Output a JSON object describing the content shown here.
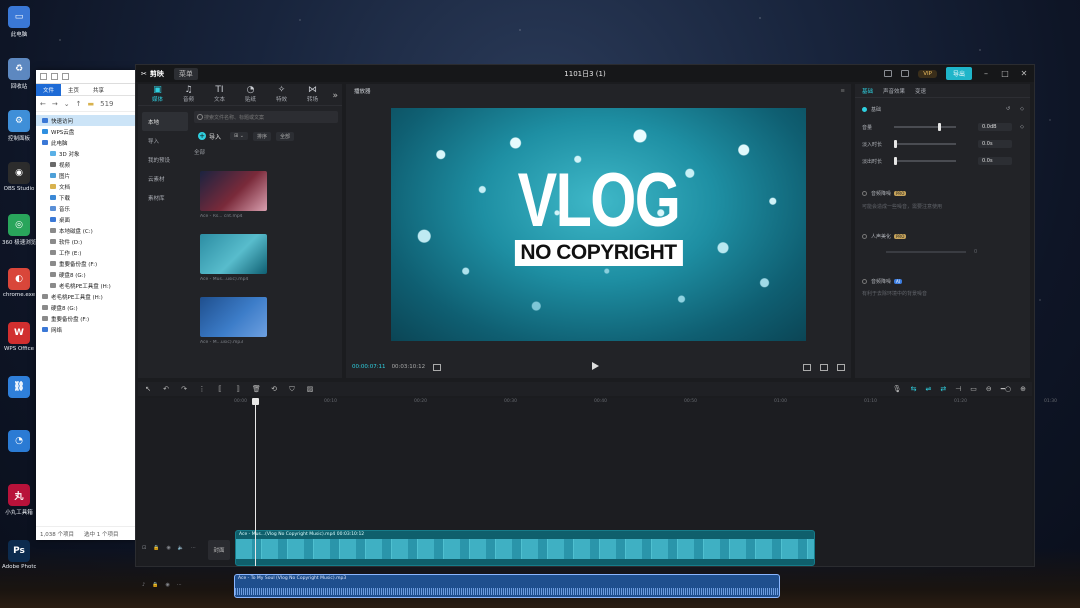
{
  "desktop": {
    "icons": [
      {
        "label": "此电脑",
        "color": "#3a78d6",
        "glyph": "▭"
      },
      {
        "label": "回收站",
        "color": "#5d88c0",
        "glyph": "♻"
      },
      {
        "label": "控制面板",
        "color": "#3f8fd8",
        "glyph": "⚙"
      },
      {
        "label": "OBS Studio",
        "color": "#2c2c2c",
        "glyph": "◉"
      },
      {
        "label": "360 极速浏览器",
        "color": "#29a55b",
        "glyph": "◎"
      },
      {
        "label": "chrome.exe",
        "color": "#d9463a",
        "glyph": "◐"
      },
      {
        "label": "WPS Office",
        "color": "#d12f2f",
        "glyph": "W"
      },
      {
        "label": "",
        "color": "#2f7fd9",
        "glyph": "⛓"
      },
      {
        "label": "",
        "color": "#2b7bd4",
        "glyph": "◔"
      },
      {
        "label": "小丸工具箱",
        "color": "#b8123a",
        "glyph": "丸"
      },
      {
        "label": "Adobe Photosh...",
        "color": "#0c2b4e",
        "glyph": "Ps"
      }
    ]
  },
  "explorer": {
    "ribbon_tabs": [
      "文件",
      "主页",
      "共享"
    ],
    "address_hint": "519",
    "nav_items": [
      {
        "label": "快速访问",
        "color": "#3a78d6",
        "selected": true,
        "sub": false
      },
      {
        "label": "WPS云盘",
        "color": "#2f8fe0",
        "selected": false,
        "sub": false
      },
      {
        "label": "此电脑",
        "color": "#3a78d6",
        "selected": false,
        "sub": false
      },
      {
        "label": "3D 对象",
        "color": "#5ab0e6",
        "selected": false,
        "sub": true
      },
      {
        "label": "视频",
        "color": "#6a6a6a",
        "selected": false,
        "sub": true
      },
      {
        "label": "图片",
        "color": "#4ea0d8",
        "selected": false,
        "sub": true
      },
      {
        "label": "文档",
        "color": "#d8b24e",
        "selected": false,
        "sub": true
      },
      {
        "label": "下载",
        "color": "#3a88d6",
        "selected": false,
        "sub": true
      },
      {
        "label": "音乐",
        "color": "#5a8fd6",
        "selected": false,
        "sub": true
      },
      {
        "label": "桌面",
        "color": "#3a78d6",
        "selected": false,
        "sub": true
      },
      {
        "label": "本地磁盘 (C:)",
        "color": "#8a8a8a",
        "selected": false,
        "sub": true
      },
      {
        "label": "软件 (D:)",
        "color": "#8a8a8a",
        "selected": false,
        "sub": true
      },
      {
        "label": "工作 (E:)",
        "color": "#8a8a8a",
        "selected": false,
        "sub": true
      },
      {
        "label": "重要备份盘 (F:)",
        "color": "#8a8a8a",
        "selected": false,
        "sub": true
      },
      {
        "label": "硬盘8 (G:)",
        "color": "#8a8a8a",
        "selected": false,
        "sub": true
      },
      {
        "label": "老毛桃PE工具盘 (H:)",
        "color": "#8a8a8a",
        "selected": false,
        "sub": true
      },
      {
        "label": "老毛桃PE工具盘 (H:)",
        "color": "#8a8a8a",
        "selected": false,
        "sub": false
      },
      {
        "label": "硬盘8 (G:)",
        "color": "#8a8a8a",
        "selected": false,
        "sub": false
      },
      {
        "label": "重要备份盘 (F:)",
        "color": "#8a8a8a",
        "selected": false,
        "sub": false
      },
      {
        "label": "网络",
        "color": "#3a78d6",
        "selected": false,
        "sub": false
      }
    ],
    "status_count": "1,038 个项目",
    "status_selected": "选中 1 个项目"
  },
  "editor": {
    "app_name": "剪映",
    "menu_label": "菜单",
    "project_title": "1101日3 (1)",
    "vip_label": "VIP",
    "export_label": "导出",
    "tools": [
      {
        "icon": "▣",
        "label": "媒体",
        "active": true
      },
      {
        "icon": "♫",
        "label": "音频",
        "active": false
      },
      {
        "icon": "TI",
        "label": "文本",
        "active": false
      },
      {
        "icon": "◔",
        "label": "贴纸",
        "active": false
      },
      {
        "icon": "✧",
        "label": "特效",
        "active": false
      },
      {
        "icon": "⋈",
        "label": "转场",
        "active": false
      }
    ],
    "media_nav": [
      "本地",
      "导入",
      "我的预设",
      "云素材",
      "素材库"
    ],
    "search_placeholder": "搜索文件名称、标题或文案",
    "import_label": "导入",
    "sort_label": "排序",
    "all_label": "全部",
    "filter_all": "全部",
    "thumbs": [
      {
        "caption": "Ace - Rs... cnt.mp4",
        "colors": [
          "#1b2340",
          "#7a2a3a",
          "#d9a0b0"
        ]
      },
      {
        "caption": "Ace - Mus...usic).mp4",
        "colors": [
          "#2c8da3",
          "#58bccc",
          "#0f5f72"
        ]
      },
      {
        "caption": "Ace - M...usic).mp3",
        "colors": [
          "#1f4f8e",
          "#3c7cc8",
          "#6ea0e0"
        ]
      }
    ],
    "player_label": "播放器",
    "timecode_current": "00:00:07:11",
    "timecode_total": "00:03:10:12",
    "video_title": "VLOG",
    "video_subtitle": "NO COPYRIGHT",
    "prop_tabs": [
      "基础",
      "声音效果",
      "变速"
    ],
    "basic_label": "基础",
    "volume_label": "音量",
    "volume_value": "0.0dB",
    "fadein_label": "淡入时长",
    "fadein_value": "0.0s",
    "fadeout_label": "淡出时长",
    "fadeout_value": "0.0s",
    "loudness_label": "音频降噪",
    "loudness_desc": "可能会造成一些噪音，需要注意使用",
    "voice_label": "人声美化",
    "voice_level": "0",
    "denoise_label": "音频降噪",
    "denoise_desc": "有利于去除环境中的背景噪音",
    "pro_badge": "PRO",
    "ai_badge": "AI",
    "ruler_ticks": [
      "00:00",
      "00:10",
      "00:20",
      "00:30",
      "00:40",
      "00:50",
      "01:00",
      "01:10",
      "01:20",
      "01:30"
    ],
    "cover_label": "封面",
    "video_clip_label": "Ace - Mus...(Vlog No Copyright Music).mp4  00:03:10:12",
    "audio_clip_label": "Ace - To My Soul (Vlog No Copyright Music).mp3"
  }
}
